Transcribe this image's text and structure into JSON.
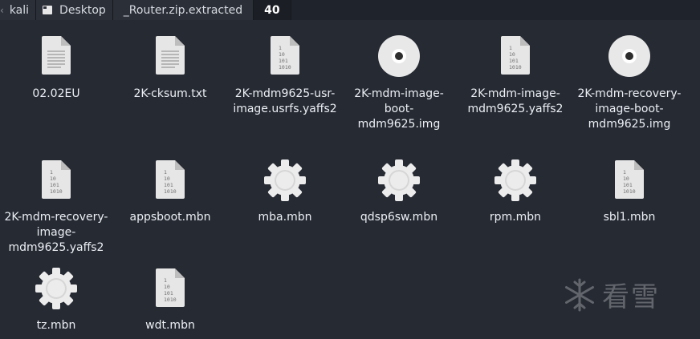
{
  "breadcrumb": {
    "items": [
      "kali",
      "Desktop",
      "_Router.zip.extracted",
      "40"
    ]
  },
  "files": [
    {
      "name": "02.02EU",
      "type": "text"
    },
    {
      "name": "2K-cksum.txt",
      "type": "text"
    },
    {
      "name": "2K-mdm9625-usr-\nimage.usrfs.yaffs2",
      "type": "binary"
    },
    {
      "name": "2K-mdm-image-\nboot-\nmdm9625.img",
      "type": "disc"
    },
    {
      "name": "2K-mdm-image-\nmdm9625.yaffs2",
      "type": "binary"
    },
    {
      "name": "2K-mdm-recovery-\nimage-boot-\nmdm9625.img",
      "type": "disc"
    },
    {
      "name": "2K-mdm-recovery-\nimage-\nmdm9625.yaffs2",
      "type": "binary"
    },
    {
      "name": "appsboot.mbn",
      "type": "binary"
    },
    {
      "name": "mba.mbn",
      "type": "gear"
    },
    {
      "name": "qdsp6sw.mbn",
      "type": "gear"
    },
    {
      "name": "rpm.mbn",
      "type": "gear"
    },
    {
      "name": "sbl1.mbn",
      "type": "binary"
    },
    {
      "name": "tz.mbn",
      "type": "gear"
    },
    {
      "name": "wdt.mbn",
      "type": "binary"
    }
  ],
  "watermark": {
    "text": "看雪"
  }
}
